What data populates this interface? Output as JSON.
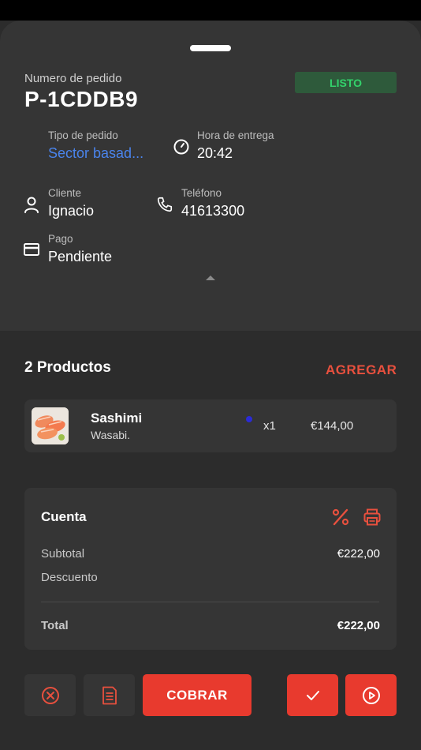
{
  "order": {
    "number_label": "Numero de pedido",
    "number": "P-1CDDB9",
    "status": "LISTO",
    "type_label": "Tipo de pedido",
    "type_value": "Sector basad...",
    "delivery_label": "Hora de entrega",
    "delivery_value": "20:42",
    "client_label": "Cliente",
    "client_value": "Ignacio",
    "phone_label": "Teléfono",
    "phone_value": "41613300",
    "payment_label": "Pago",
    "payment_value": "Pendiente"
  },
  "products": {
    "title": "2 Productos",
    "add_label": "AGREGAR",
    "items": [
      {
        "name": "Sashimi",
        "note": "Wasabi.",
        "qty": "x1",
        "price": "€144,00",
        "dot_color": "#2b2bd6"
      }
    ]
  },
  "account": {
    "title": "Cuenta",
    "subtotal_label": "Subtotal",
    "subtotal_value": "€222,00",
    "discount_label": "Descuento",
    "total_label": "Total",
    "total_value": "€222,00"
  },
  "actions": {
    "charge_label": "COBRAR"
  },
  "colors": {
    "accent": "#e83a2e",
    "link": "#4a84ec",
    "status_bg": "#2e5a3b",
    "status_text": "#33d26b"
  },
  "icons": {
    "clock": "clock-icon",
    "user": "user-icon",
    "phone": "phone-icon",
    "card": "credit-card-icon",
    "percent": "percent-icon",
    "print": "printer-icon",
    "cancel": "cancel-circle-icon",
    "receipt": "receipt-icon",
    "check": "check-icon",
    "play": "play-circle-icon"
  }
}
